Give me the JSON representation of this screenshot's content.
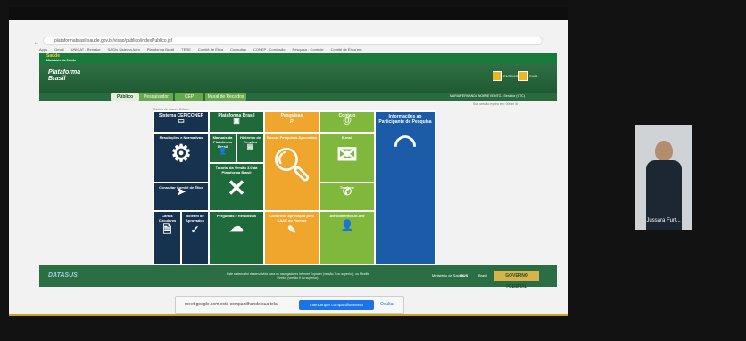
{
  "browser": {
    "url": "plataformabrasil.saude.gov.br/visao/publico/indexPublico.jsf",
    "nav_icons": "← → ↻ ⓘ",
    "bookmarks": [
      "Apps",
      "Gmail",
      "UNICAT - Remake",
      "SAGIs Sistema Adm",
      "Plataforma Brasil",
      "TERE",
      "Comitê de Ética",
      "Consultas",
      "CONEP - Comissão",
      "Pesquisa - Controle",
      "Comitê de Ética em"
    ]
  },
  "gov_bar": {
    "title": "Saúde",
    "subtitle": "Ministério da Saúde"
  },
  "header": {
    "logo_line1": "Plataforma",
    "logo_line2": "Brasil",
    "btn_entrar": "ENTRAR",
    "btn_sair": "SAIR",
    "user_info": "MARIA FERNANDA NOBRE BENTO - Servidor (UTC)"
  },
  "tabs": [
    "Público",
    "Pesquisador",
    "CEP",
    "Mural de Recados"
  ],
  "small_labels": {
    "date": "Sua sessão expira em: 09min 56",
    "tiles_title": "Página de acesso Público"
  },
  "tiles": {
    "sistema_cep_conep": "Sistema CEP/CONEP",
    "plataforma_brasil": "Plataforma Brasil",
    "pesquisas": "Pesquisas",
    "contato": "Contato",
    "informacoes": "Informações ao Participante de Pesquisa",
    "resolucoes": "Resoluções e Normativas",
    "manual": "Manuais da Plataforma Brasil",
    "historico": "Histórico de Versões",
    "buscar_pesquisas": "Buscar Pesquisas Aprovadas",
    "email": "E-mail",
    "tutorial": "Tutorial da Versão 3.0 da Plataforma Brasil",
    "consultar_cep": "Consultar Comitê de Ética",
    "telefone": "Telefone",
    "cartas_circulares": "Cartas Circulares",
    "boletim": "Boletim de Aprovados",
    "perguntas": "Perguntas e Respostas",
    "confirmar_cep": "Confirmar aprovação pelo CAAE ou Parecer",
    "atendimento": "Atendimento On-line"
  },
  "footer": {
    "left": "DATASUS",
    "middle": "Este sistema foi desenvolvido para os navegadores Internet Explorer (versão 7 ou superior), ou Mozilla Firefox (versão 9 ou superior).",
    "logo1": "Ministério da Saúde",
    "logo2": "SUS",
    "logo3": "Brasil",
    "box": "GOVERNO FEDERAL"
  },
  "share_banner": {
    "text": "meet.google.com está compartilhando sua tela.",
    "stop_button": "Interromper compartilhamento",
    "hide_button": "Ocultar"
  },
  "participant": {
    "name": "Jussara Furt..."
  }
}
